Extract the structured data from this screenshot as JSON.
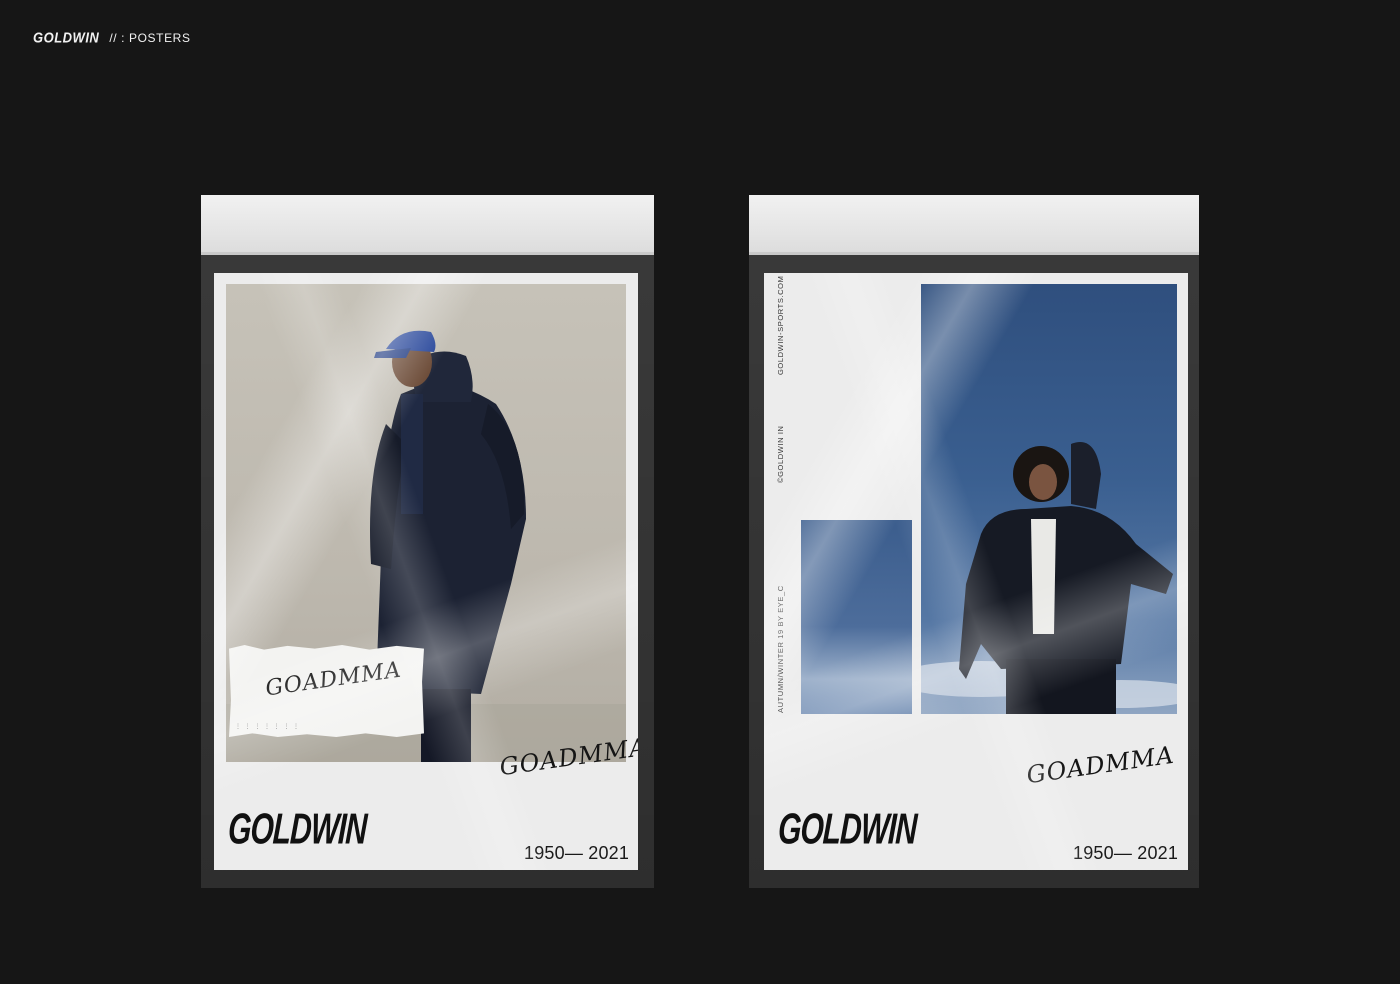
{
  "header": {
    "brand": "GOLDWIN",
    "section": "// : POSTERS"
  },
  "posters": [
    {
      "signature": "GOADMMA",
      "note_signature": "GOADMMA",
      "logo": "GOLDWIN",
      "years": "1950— 2021"
    },
    {
      "signature": "GOADMMA",
      "logo": "GOLDWIN",
      "years": "1950— 2021",
      "side_text_1": "AUTUMN/WINTER 19 BY EYE_C",
      "side_text_2": "©GOLDWIN IN",
      "side_text_3": "GOLDWIN-SPORTS.COM"
    }
  ]
}
